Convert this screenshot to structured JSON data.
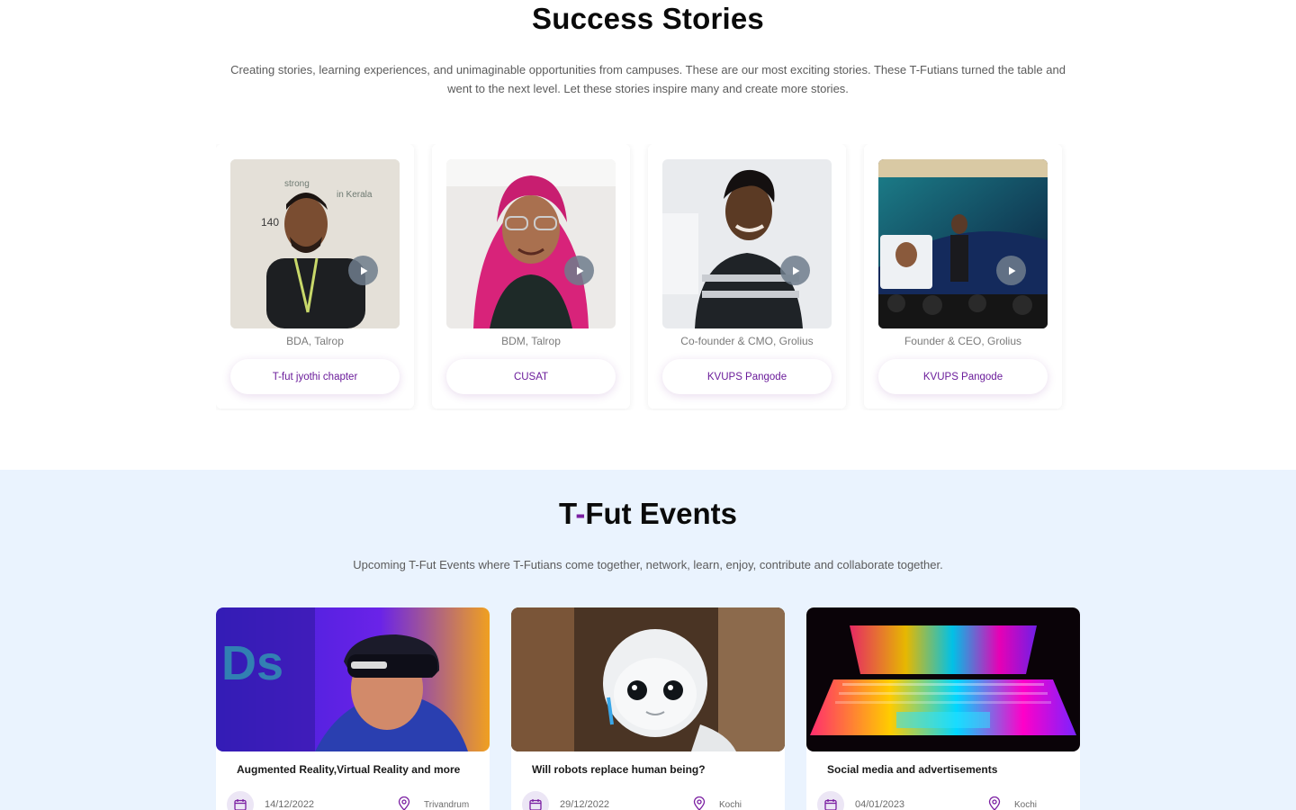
{
  "stories": {
    "title": "Success Stories",
    "subtitle": "Creating stories, learning experiences, and unimaginable opportunities from campuses. These are our most exciting stories. These T-Futians turned the table and went to the next level. Let these stories inspire many and create more stories.",
    "cards": [
      {
        "role": "BDA, Talrop",
        "chapter": "T-fut jyothi chapter",
        "play_icon": "play-icon"
      },
      {
        "role": "BDM, Talrop",
        "chapter": "CUSAT",
        "play_icon": "play-icon"
      },
      {
        "role": "Co-founder & CMO, Grolius",
        "chapter": "KVUPS Pangode",
        "play_icon": "play-icon"
      },
      {
        "role": "Founder & CEO, Grolius",
        "chapter": "KVUPS Pangode",
        "play_icon": "play-icon"
      }
    ]
  },
  "events": {
    "title_prefix": "T",
    "title_dash": "-",
    "title_rest": "Fut Events",
    "subtitle": "Upcoming T-Fut Events where T-Futians come together, network, learn, enjoy, contribute and collaborate together.",
    "items": [
      {
        "title": "Augmented Reality,Virtual Reality and more",
        "date": "14/12/2022",
        "location": "Trivandrum"
      },
      {
        "title": "Will robots replace human being?",
        "date": "29/12/2022",
        "location": "Kochi"
      },
      {
        "title": "Social media and advertisements",
        "date": "04/01/2023",
        "location": "Kochi"
      }
    ]
  },
  "colors": {
    "accent": "#7b1fa2",
    "events_background": "#eaf3fe",
    "chip_text": "#6a1b9a"
  },
  "icons": [
    "play-icon",
    "calendar-icon",
    "location-pin-icon"
  ]
}
